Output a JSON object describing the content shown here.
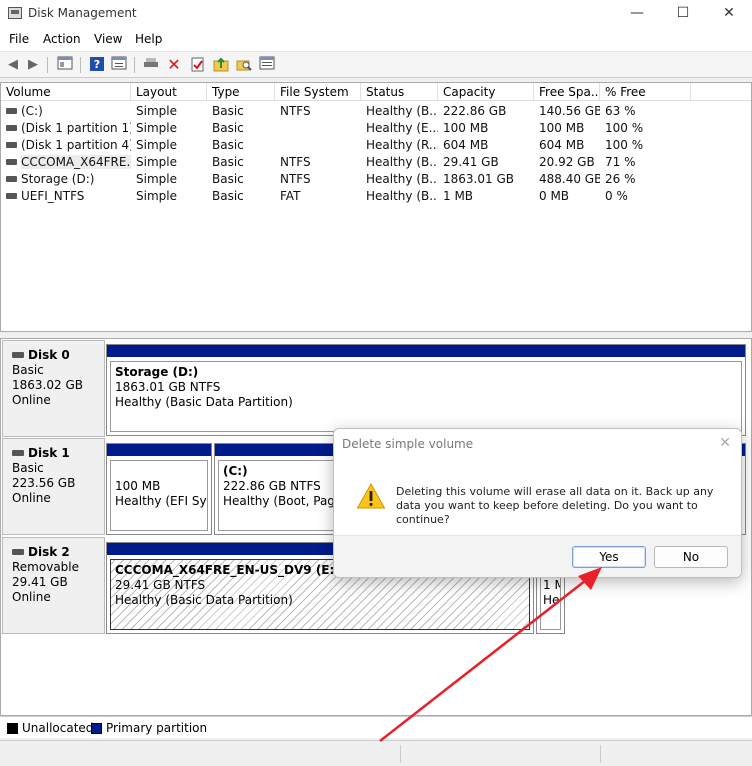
{
  "window": {
    "title": "Disk Management",
    "minimize": "—",
    "maximize": "☐",
    "close": "✕"
  },
  "menu": [
    "File",
    "Action",
    "View",
    "Help"
  ],
  "volume_list": {
    "columns": [
      "Volume",
      "Layout",
      "Type",
      "File System",
      "Status",
      "Capacity",
      "Free Spa...",
      "% Free"
    ],
    "rows": [
      [
        "(C:)",
        "Simple",
        "Basic",
        "NTFS",
        "Healthy (B...",
        "222.86 GB",
        "140.56 GB",
        "63 %"
      ],
      [
        "(Disk 1 partition 1)",
        "Simple",
        "Basic",
        "",
        "Healthy (E...",
        "100 MB",
        "100 MB",
        "100 %"
      ],
      [
        "(Disk 1 partition 4)",
        "Simple",
        "Basic",
        "",
        "Healthy (R...",
        "604 MB",
        "604 MB",
        "100 %"
      ],
      [
        "CCCOMA_X64FRE...",
        "Simple",
        "Basic",
        "NTFS",
        "Healthy (B...",
        "29.41 GB",
        "20.92 GB",
        "71 %"
      ],
      [
        "Storage (D:)",
        "Simple",
        "Basic",
        "NTFS",
        "Healthy (B...",
        "1863.01 GB",
        "488.40 GB",
        "26 %"
      ],
      [
        "UEFI_NTFS",
        "Simple",
        "Basic",
        "FAT",
        "Healthy (B...",
        "1 MB",
        "0 MB",
        "0 %"
      ]
    ]
  },
  "disks": [
    {
      "name": "Disk 0",
      "type": "Basic",
      "size": "1863.02 GB",
      "state": "Online",
      "partitions": [
        {
          "name": "Storage  (D:)",
          "size": "1863.01 GB NTFS",
          "status": "Healthy (Basic Data Partition)"
        }
      ]
    },
    {
      "name": "Disk 1",
      "type": "Basic",
      "size": "223.56 GB",
      "state": "Online",
      "partitions": [
        {
          "name": "",
          "size": "100 MB",
          "status": "Healthy (EFI Syste"
        },
        {
          "name": "(C:)",
          "size": "222.86 GB NTFS",
          "status": "Healthy (Boot, Page F"
        }
      ]
    },
    {
      "name": "Disk 2",
      "type": "Removable",
      "size": "29.41 GB",
      "state": "Online",
      "partitions": [
        {
          "name": "CCCOMA_X64FRE_EN-US_DV9  (E:)",
          "size": "29.41 GB NTFS",
          "status": "Healthy (Basic Data Partition)"
        },
        {
          "name": "",
          "size": "1 M",
          "status": "He"
        }
      ]
    }
  ],
  "legend": [
    {
      "label": "Unallocated",
      "color": "#000000"
    },
    {
      "label": "Primary partition",
      "color": "#001b8c"
    }
  ],
  "dialog": {
    "title": "Delete simple volume",
    "message": "Deleting this volume will erase all data on it. Back up any data you want to keep before deleting. Do you want to continue?",
    "yes": "Yes",
    "no": "No",
    "close": "✕"
  },
  "colors": {
    "primary_partition": "#001b8c",
    "annotation_arrow": "#e8202a"
  }
}
